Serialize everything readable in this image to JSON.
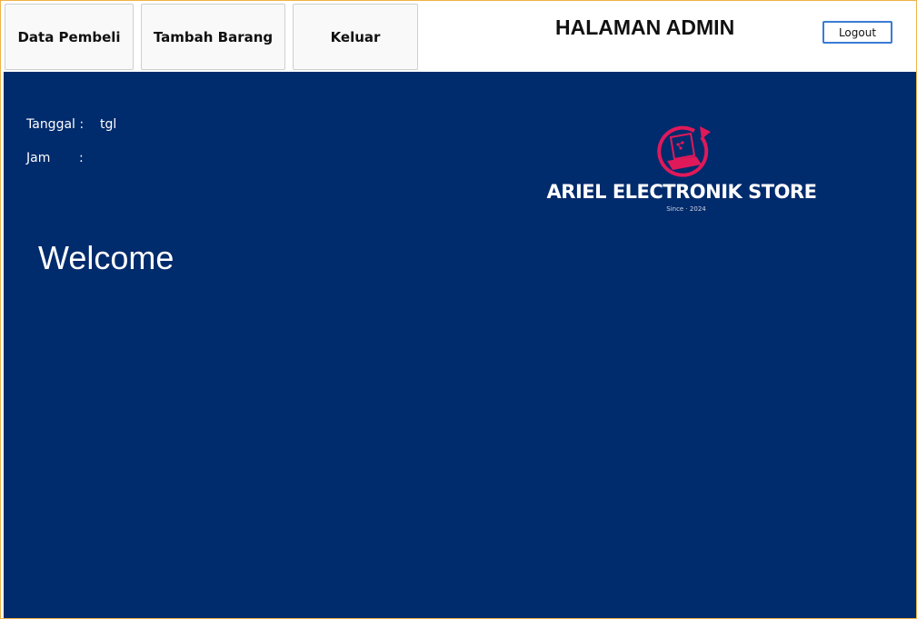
{
  "nav": {
    "data_pembeli": "Data Pembeli",
    "tambah_barang": "Tambah Barang",
    "keluar": "Keluar"
  },
  "header": {
    "title": "HALAMAN ADMIN",
    "logout_label": "Logout"
  },
  "info": {
    "tanggal_label": "Tanggal :",
    "tanggal_value": "tgl",
    "jam_label": "Jam",
    "jam_colon": ":"
  },
  "main": {
    "welcome": "Welcome"
  },
  "logo": {
    "name": "ARIEL ELECTRONIK STORE",
    "since": "Since · 2024",
    "icon": "laptop-circle-icon"
  },
  "colors": {
    "main_background": "#002b6c",
    "logo_accent": "#e0195a",
    "logout_border": "#3a7bd5"
  }
}
